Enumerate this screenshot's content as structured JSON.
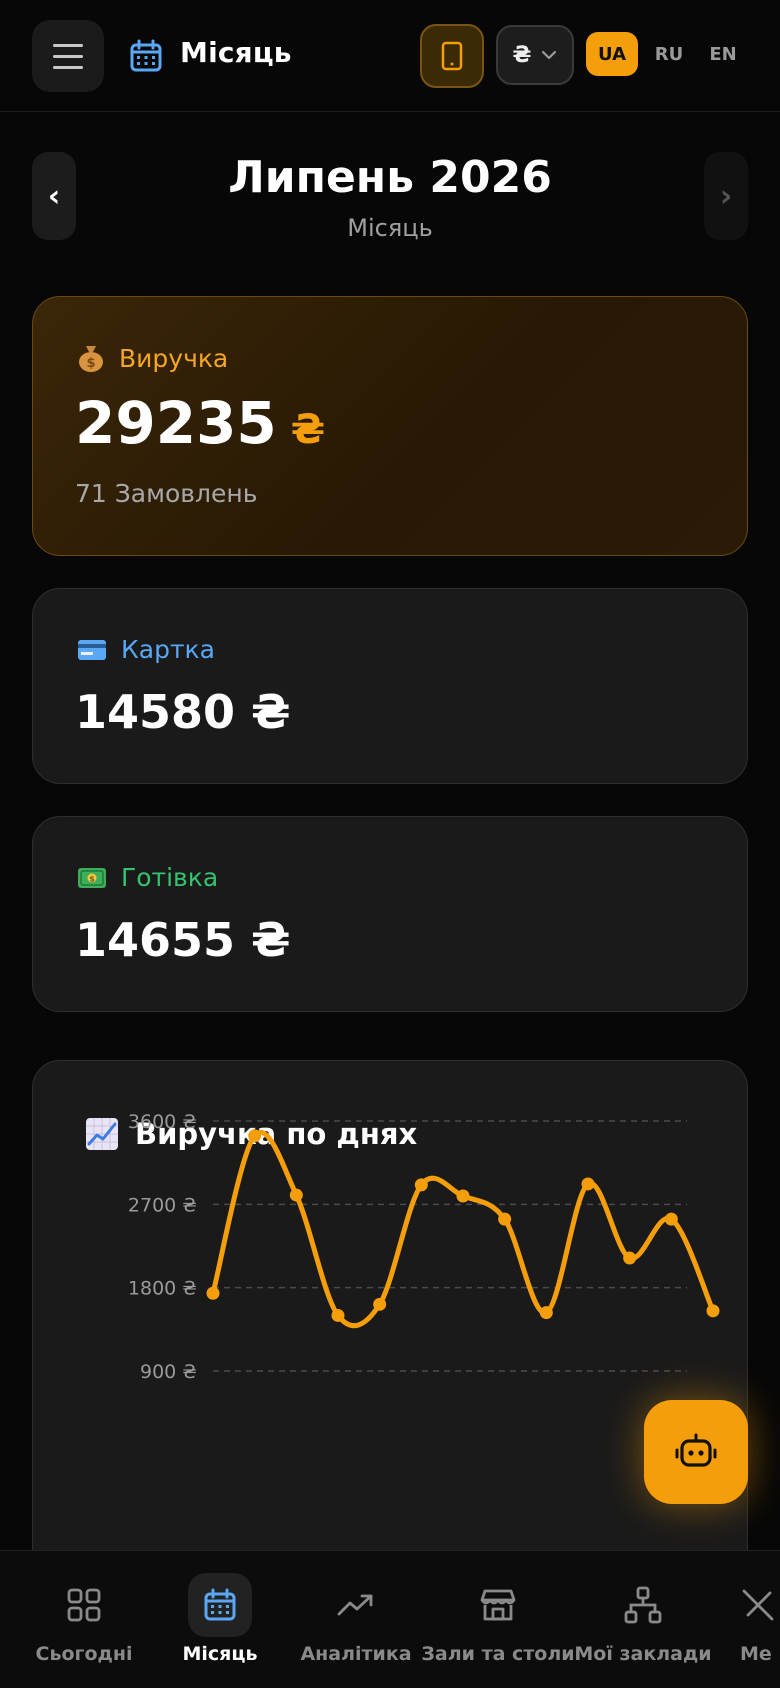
{
  "header": {
    "title": "Місяць",
    "currency_symbol": "₴",
    "languages": [
      {
        "code": "UA",
        "active": true
      },
      {
        "code": "RU",
        "active": false
      },
      {
        "code": "EN",
        "active": false
      }
    ]
  },
  "month_nav": {
    "prev": "‹",
    "next": "›",
    "title": "Липень 2026",
    "subtitle": "Місяць"
  },
  "revenue": {
    "icon": "money-bag-icon",
    "label": "Виручка",
    "value": "29235",
    "currency": "₴",
    "orders": "71 Замовлень"
  },
  "card_payment": {
    "icon": "credit-card-icon",
    "label": "Картка",
    "value": "14580 ₴"
  },
  "cash_payment": {
    "icon": "cash-icon",
    "label": "Готівка",
    "value": "14655 ₴"
  },
  "chart_section": {
    "icon": "chart-increasing-icon",
    "title": "Виручка по днях"
  },
  "chart_data": {
    "type": "line",
    "title": "Виручка по днях",
    "ylabel": "",
    "xlabel": "",
    "y_ticks": [
      "3600 ₴",
      "2700 ₴",
      "1800 ₴",
      "900 ₴"
    ],
    "y_tick_values": [
      3600,
      2700,
      1800,
      900
    ],
    "ylim": [
      0,
      3600
    ],
    "grid": true,
    "color": "#f59e0b",
    "series": [
      {
        "values": [
          1740,
          3440,
          2800,
          1500,
          1620,
          2910,
          2790,
          2540,
          1530,
          2920,
          2120,
          2540,
          1550
        ]
      }
    ]
  },
  "bottom_nav": [
    {
      "label": "Сьогодні",
      "icon": "dashboard-grid-icon",
      "active": false
    },
    {
      "label": "Місяць",
      "icon": "calendar-icon",
      "active": true
    },
    {
      "label": "Аналітика",
      "icon": "trend-up-icon",
      "active": false
    },
    {
      "label": "Зали та столи",
      "icon": "store-icon",
      "active": false
    },
    {
      "label": "Мої заклади",
      "icon": "network-icon",
      "active": false
    },
    {
      "label": "Ме",
      "icon": "tools-icon",
      "active": false
    }
  ],
  "colors": {
    "accent": "#f59e0b",
    "card_label": "#5aa7f5",
    "cash_label": "#34c46e",
    "background": "#070707"
  }
}
